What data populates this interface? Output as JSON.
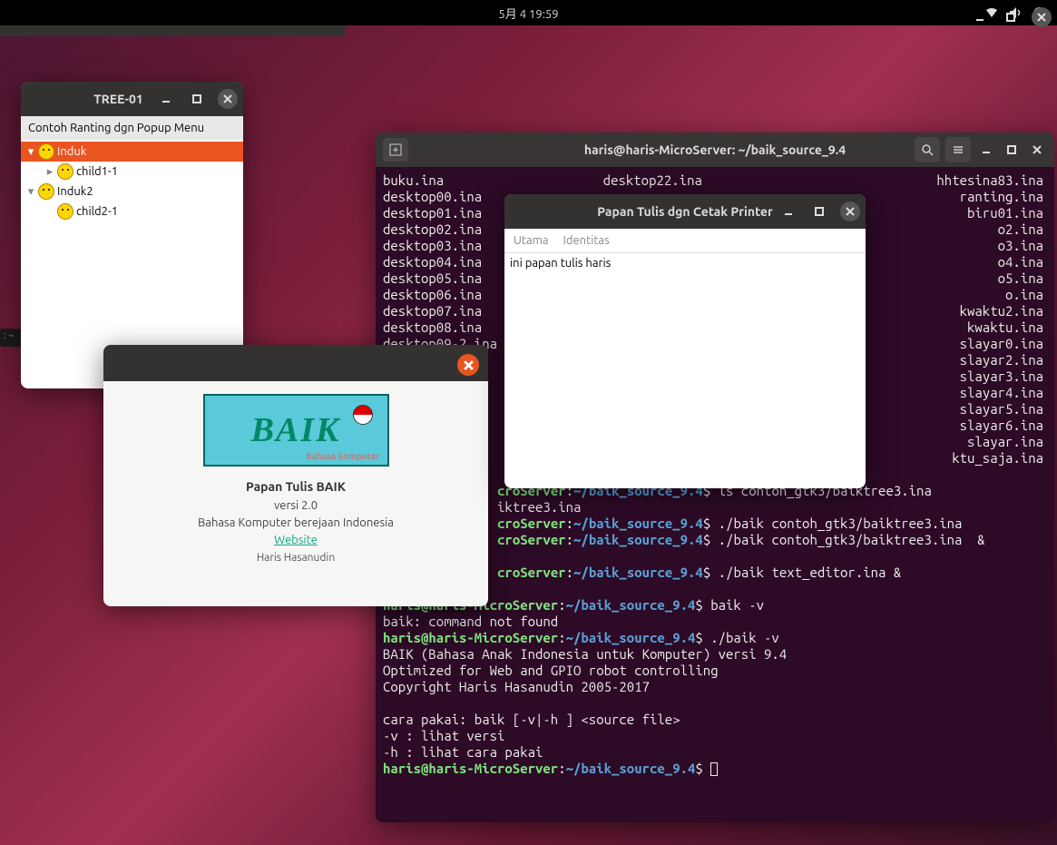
{
  "panel": {
    "datetime": "5月 4  19:59"
  },
  "tree_window": {
    "title": "TREE-01",
    "header": "Contoh Ranting dgn Popup Menu",
    "nodes": {
      "induk": "Induk",
      "child1_1": "child1-1",
      "induk2": "Induk2",
      "child2_1": "child2-1"
    }
  },
  "small_tab": ": ~",
  "about": {
    "logo_text": "BAIK",
    "logo_sub": "bahasa komputer",
    "title": "Papan Tulis BAIK",
    "version": "versi 2.0",
    "desc": "Bahasa Komputer berejaan Indonesia",
    "link": "Website",
    "author": "Haris Hasanudin"
  },
  "terminal": {
    "title": "haris@haris-MicroServer: ~/baik_source_9.4",
    "col1": [
      "buku.ina",
      "desktop00.ina",
      "desktop01.ina",
      "desktop02.ina",
      "desktop03.ina",
      "desktop04.ina",
      "desktop05.ina",
      "desktop06.ina",
      "desktop07.ina",
      "desktop08.ina",
      "desktop09-2.ina"
    ],
    "col2": [
      "desktop22.ina"
    ],
    "col3": [
      "hhtesina83.ina",
      "",
      "biru01.ina",
      "o2.ina",
      "o3.ina",
      "o4.ina",
      "o5.ina",
      "o.ina",
      "kwaktu2.ina",
      "kwaktu.ina",
      "slayar0.ina",
      "slayar2.ina",
      "slayar3.ina",
      "slayar4.ina",
      "slayar5.ina",
      "slayar6.ina",
      "slayar.ina",
      "ktu_saja.ina"
    ],
    "lines": {
      "user": "haris@haris-MicroServer",
      "path": "~/baik_source_9.4",
      "cmd1": "ls contoh_gtk3/baiktree3.ina",
      "out1": "iktree3.ina",
      "cmd2": "./baik contoh_gtk3/baiktree3.ina",
      "cmd3": "./baik contoh_gtk3/baiktree3.ina  &",
      "cmd4": "./baik text_editor.ina &",
      "cmd5": "baik -v",
      "out5": "baik: command not found",
      "cmd6": "./baik -v",
      "out6a": "BAIK (Bahasa Anak Indonesia untuk Komputer) versi 9.4",
      "out6b": "Optimized for Web and GPIO robot controlling",
      "out6c": "Copyright Haris Hasanudin 2005-2017",
      "out6d": "cara pakai: baik [-v|-h ] <source file>",
      "out6e": "-v : lihat versi",
      "out6f": "-h : lihat cara pakai"
    }
  },
  "papan": {
    "title": "Papan Tulis dgn Cetak Printer",
    "menu1": "Utama",
    "menu2": "Identitas",
    "content": "ini papan tulis haris"
  }
}
